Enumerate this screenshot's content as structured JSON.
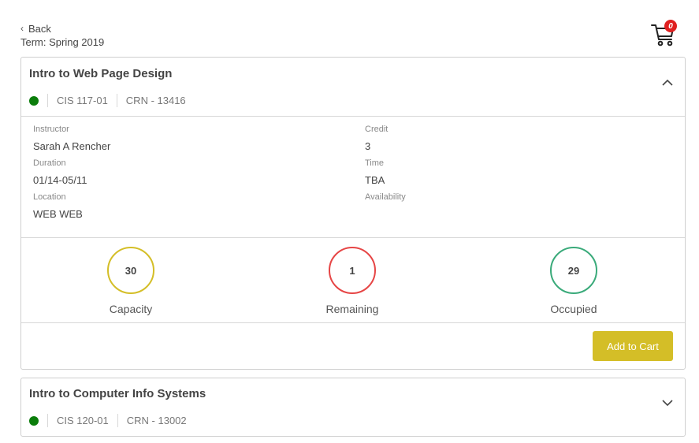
{
  "header": {
    "back_label": "Back",
    "term_label": "Term: Spring 2019"
  },
  "cart": {
    "count": "0",
    "icon": "cart-icon",
    "badge_color": "#e02020"
  },
  "courses": [
    {
      "title": "Intro to Web Page Design",
      "course_code": "CIS 117-01",
      "crn": "CRN - 13416",
      "status_color": "#0b7d0b",
      "expanded": true,
      "details": {
        "instructor_label": "Instructor",
        "instructor": "Sarah A Rencher",
        "credit_label": "Credit",
        "credit": "3",
        "duration_label": "Duration",
        "duration": "01/14-05/11",
        "time_label": "Time",
        "time": "TBA",
        "location_label": "Location",
        "location": "WEB WEB",
        "availability_label": "Availability"
      },
      "stats": [
        {
          "label": "Capacity",
          "value": "30",
          "color": "#d4be27"
        },
        {
          "label": "Remaining",
          "value": "1",
          "color": "#e64545"
        },
        {
          "label": "Occupied",
          "value": "29",
          "color": "#3aaa7a"
        }
      ],
      "add_button_label": "Add to Cart",
      "add_button_color": "#d4be27"
    },
    {
      "title": "Intro to Computer Info Systems",
      "course_code": "CIS 120-01",
      "crn": "CRN - 13002",
      "status_color": "#0b7d0b",
      "expanded": false
    }
  ]
}
